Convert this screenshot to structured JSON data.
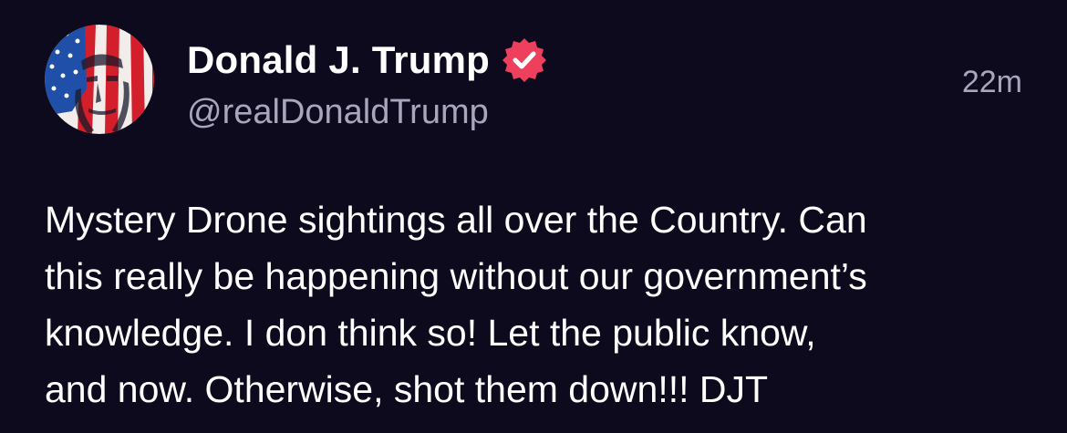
{
  "author": {
    "display_name": "Donald J. Trump",
    "handle": "@realDonaldTrump",
    "verified": true,
    "verified_badge_color": "#ee3f5c",
    "avatar_icon": "avatar-flag-portrait"
  },
  "post": {
    "timestamp": "22m",
    "text": "Mystery Drone sightings all over the Country. Can\nthis really be happening without our government’s\nknowledge. I don think so! Let the public know,\nand now. Otherwise, shot them down!!! DJT"
  },
  "colors": {
    "background": "#0c0a1c",
    "primary_text": "#ffffff",
    "secondary_text": "#a9a5bd"
  }
}
